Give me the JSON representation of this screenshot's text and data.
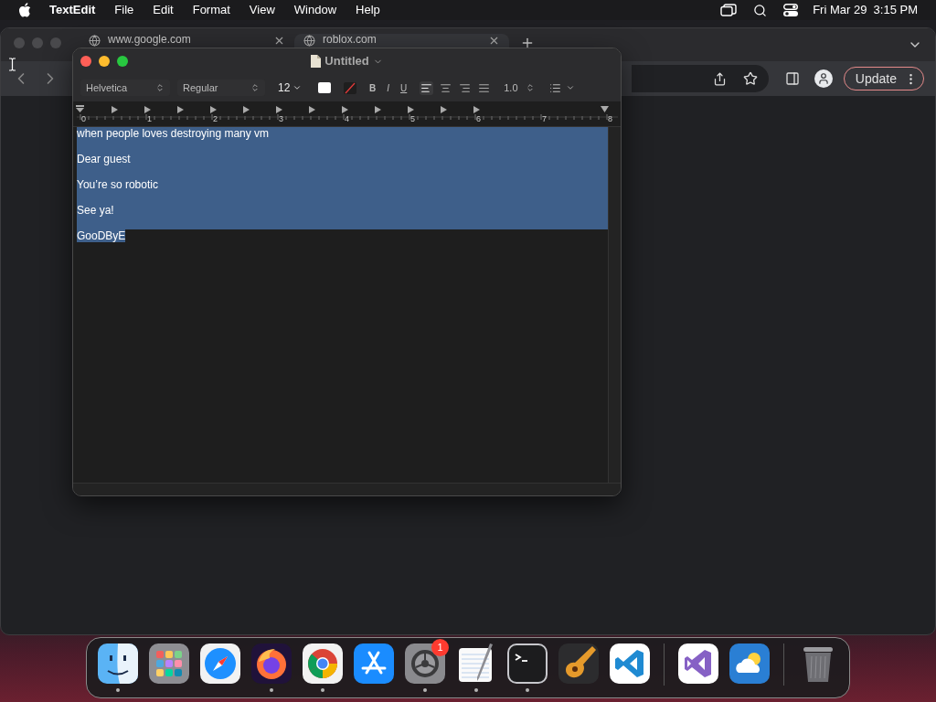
{
  "menu_bar": {
    "app": "TextEdit",
    "items": [
      "File",
      "Edit",
      "Format",
      "View",
      "Window",
      "Help"
    ],
    "clock": "Fri Mar 29  3:15 PM"
  },
  "browser": {
    "tabs": [
      {
        "title": "www.google.com",
        "selected": false
      },
      {
        "title": "roblox.com",
        "selected": true
      }
    ],
    "update_button": "Update"
  },
  "textedit": {
    "title": "Untitled",
    "toolbar": {
      "font": "Helvetica",
      "style": "Regular",
      "size": "12",
      "bold": "B",
      "italic": "I",
      "underline": "U",
      "spacing": "1.0",
      "alignment_buttons": [
        {
          "kind": "left",
          "selected": true
        },
        {
          "kind": "center",
          "selected": false
        },
        {
          "kind": "right",
          "selected": false
        },
        {
          "kind": "justify",
          "selected": false
        }
      ]
    },
    "ruler": [
      "0",
      "1",
      "2",
      "3",
      "4",
      "5",
      "6",
      "7",
      "8"
    ],
    "paragraphs": [
      {
        "text": "when people loves destroying many vm",
        "selected": true
      },
      {
        "text": "Dear guest",
        "selected": true
      },
      {
        "text": "You’re so robotic",
        "selected": true
      },
      {
        "text": "See ya!",
        "selected": true
      },
      {
        "text": "GooDByE",
        "selected": true
      }
    ]
  },
  "dock": [
    {
      "kind": "finder",
      "running": true
    },
    {
      "kind": "launchpad",
      "running": false
    },
    {
      "kind": "safari",
      "running": false
    },
    {
      "kind": "firefox",
      "running": true
    },
    {
      "kind": "chrome",
      "running": true
    },
    {
      "kind": "appstore",
      "running": false
    },
    {
      "kind": "settings",
      "running": true,
      "badge": "1"
    },
    {
      "kind": "textedit",
      "running": true
    },
    {
      "kind": "terminal",
      "running": true
    },
    {
      "kind": "garageband",
      "running": false
    },
    {
      "kind": "vscode",
      "running": false
    },
    {
      "kind": "separator"
    },
    {
      "kind": "visualstudio",
      "running": false
    },
    {
      "kind": "weather",
      "running": false
    },
    {
      "kind": "separator"
    },
    {
      "kind": "trash",
      "running": false
    }
  ]
}
